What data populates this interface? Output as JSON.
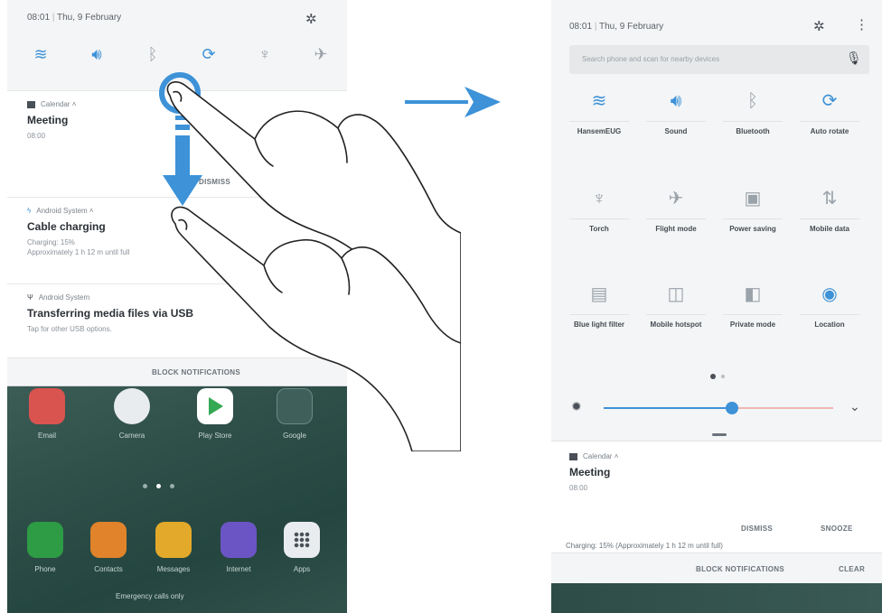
{
  "left_phone": {
    "status_time": "08:01",
    "status_date": "Thu, 9 February",
    "quick_icons": [
      {
        "name": "wifi",
        "glyph": "≋",
        "active": true
      },
      {
        "name": "sound",
        "glyph": "🔊︎",
        "active": true
      },
      {
        "name": "bluetooth",
        "glyph": "ᛒ",
        "active": false
      },
      {
        "name": "auto-rotate",
        "glyph": "⟳",
        "active": true
      },
      {
        "name": "torch",
        "glyph": "♆",
        "active": false
      },
      {
        "name": "flight-mode",
        "glyph": "✈",
        "active": false
      }
    ],
    "notifications": [
      {
        "app": "Calendar",
        "title": "Meeting",
        "sub": "08:00",
        "button": "DISMISS"
      },
      {
        "app": "Android System",
        "title": "Cable charging",
        "sub": "Charging: 15%",
        "sub2": "Approximately 1 h 12 m until full"
      },
      {
        "app": "Android System",
        "title": "Transferring media files via USB",
        "sub": "Tap for other USB options."
      }
    ],
    "block_notifications": "BLOCK NOTIFICATIONS",
    "home_apps": [
      "Email",
      "Camera",
      "Play Store",
      "Google"
    ],
    "dock_apps": [
      "Phone",
      "Contacts",
      "Messages",
      "Internet",
      "Apps"
    ],
    "emergency_text": "Emergency calls only"
  },
  "right_phone": {
    "status_time": "08:01",
    "status_date": "Thu, 9 February",
    "search_placeholder": "Search phone and scan for nearby devices",
    "tiles": [
      {
        "label": "HansemEUG",
        "glyph": "≋",
        "active": true
      },
      {
        "label": "Sound",
        "glyph": "🔊︎",
        "active": true
      },
      {
        "label": "Bluetooth",
        "glyph": "ᛒ",
        "active": false
      },
      {
        "label": "Auto rotate",
        "glyph": "⟳",
        "active": true
      },
      {
        "label": "Torch",
        "glyph": "♆",
        "active": false
      },
      {
        "label": "Flight mode",
        "glyph": "✈",
        "active": false
      },
      {
        "label": "Power saving",
        "glyph": "▣",
        "active": false
      },
      {
        "label": "Mobile data",
        "glyph": "⇅",
        "active": false
      },
      {
        "label": "Blue light filter",
        "glyph": "▤",
        "active": false
      },
      {
        "label": "Mobile hotspot",
        "glyph": "◫",
        "active": false
      },
      {
        "label": "Private mode",
        "glyph": "◧",
        "active": false
      },
      {
        "label": "Location",
        "glyph": "◉",
        "active": true
      }
    ],
    "brightness_level": 0.56,
    "notification": {
      "app": "Calendar",
      "title": "Meeting",
      "sub": "08:00",
      "dismiss": "DISMISS",
      "snooze": "SNOOZE"
    },
    "peek_text": "Charging: 15% (Approximately 1 h 12 m until full)",
    "block_notifications": "BLOCK NOTIFICATIONS",
    "clear": "CLEAR"
  },
  "colors": {
    "accent": "#3d92d8"
  }
}
